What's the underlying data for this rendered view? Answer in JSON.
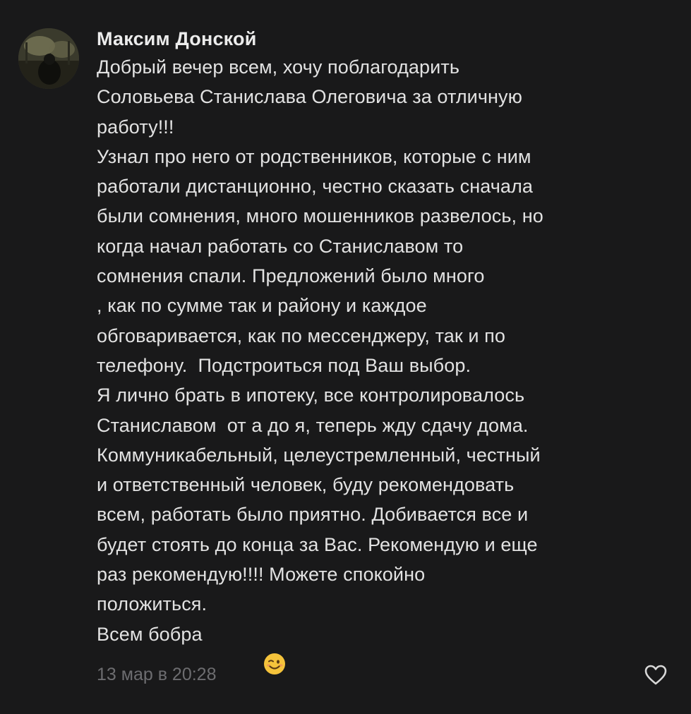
{
  "comment": {
    "author": "Максим Донской",
    "lines": [
      "Добрый вечер всем, хочу поблагодарить",
      "Соловьева Станислава Олеговича за отличную",
      "работу!!!",
      "Узнал про него от родственников, которые с ним",
      "работали дистанционно, честно сказать сначала",
      "были сомнения, много мошенников развелось, но",
      "когда начал работать со Станиславом то",
      "сомнения спали. Предложений было много",
      ", как по сумме так и району и каждое",
      "обговаривается, как по мессенджеру, так и по",
      "телефону.  Подстроиться под Ваш выбор.",
      "Я лично брать в ипотеку, все контролировалось",
      "Станиславом  от а до я, теперь жду сдачу дома.",
      "Коммуникабельный, целеустремленный, честный",
      "и ответственный человек, буду рекомендовать",
      "всем, работать было приятно. Добивается все и",
      "будет стоять до конца за Вас. Рекомендую и еще",
      "раз рекомендую!!!! Можете спокойно",
      "положиться."
    ],
    "last_line": "Всем бобра",
    "emoji": "winking-face",
    "timestamp": "13 мар в 20:28",
    "like_icon": "heart-outline-icon"
  },
  "colors": {
    "background": "#19191a",
    "text": "#e2e2e2",
    "meta": "#6d6d70",
    "emoji": "#f5c33b"
  }
}
